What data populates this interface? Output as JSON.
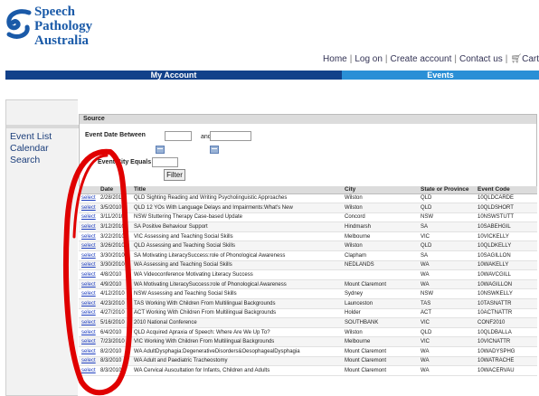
{
  "brand": {
    "line1": "Speech",
    "line2": "Pathology",
    "line3": "Australia"
  },
  "toplinks": [
    "Home",
    "Log on",
    "Create account",
    "Contact us",
    "Cart"
  ],
  "nav": {
    "account": "My Account",
    "events": "Events"
  },
  "sidebar": {
    "items": [
      "Event List",
      "Calendar",
      "Search"
    ]
  },
  "filter": {
    "section_label": "Source",
    "date_between_label": "Event Date Between",
    "and_label": "and",
    "city_label": "Event City Equals",
    "filter_button": "Filter",
    "date_from": "",
    "date_to": "",
    "city": ""
  },
  "table": {
    "headers": [
      "",
      "Date",
      "Title",
      "City",
      "State or Province",
      "Event Code"
    ],
    "select_label": "select",
    "rows": [
      [
        "2/28/2010",
        "QLD Sighting Reading and Writing Psycholinguistic Approaches",
        "Wilston",
        "QLD",
        "10QLDCARDE"
      ],
      [
        "3/5/2010",
        "QLD 12 YOs With Language Delays and Impairments:What's New",
        "Wilston",
        "QLD",
        "10QLDSHORT"
      ],
      [
        "3/11/2010",
        "NSW Stuttering Therapy Case-based Update",
        "Concord",
        "NSW",
        "10NSWSTUTT"
      ],
      [
        "3/12/2010",
        "SA Positive Behaviour Support",
        "Hindmarsh",
        "SA",
        "10SABEHGIL"
      ],
      [
        "3/22/2010",
        "VIC Assessing and Teaching Social Skills",
        "Melbourne",
        "VIC",
        "10VICKELLY"
      ],
      [
        "3/26/2010",
        "QLD Assessing and Teaching Social Skills",
        "Wilston",
        "QLD",
        "10QLDKELLY"
      ],
      [
        "3/30/2010",
        "SA Motivating LiteracySuccess:role of Phonological Awareness",
        "Clapham",
        "SA",
        "10SAGILLON"
      ],
      [
        "3/30/2010",
        "WA Assessing and Teaching Social Skills",
        "NEDLANDS",
        "WA",
        "10WAKELLY"
      ],
      [
        "4/8/2010",
        "WA Videoconference Motivating Literacy Success",
        "",
        "WA",
        "10WAVCGILL"
      ],
      [
        "4/9/2010",
        "WA Motivating LiteracySuccess:role of Phonological Awareness",
        "Mount Claremont",
        "WA",
        "10WAGILLON"
      ],
      [
        "4/12/2010",
        "NSW Assessing and Teaching Social Skills",
        "Sydney",
        "NSW",
        "10NSWKELLY"
      ],
      [
        "4/23/2010",
        "TAS Working With Children From Multilingual Backgrounds",
        "Launceston",
        "TAS",
        "10TASNATTR"
      ],
      [
        "4/27/2010",
        "ACT Working With Children From Multilingual Backgrounds",
        "Holder",
        "ACT",
        "10ACTNATTR"
      ],
      [
        "5/16/2010",
        "2010 National Conference",
        "SOUTHBANK",
        "VIC",
        "CONF2010"
      ],
      [
        "6/4/2010",
        "QLD Acquired Apraxia of Speech: Where Are We Up To?",
        "Wilston",
        "QLD",
        "10QLDBALLA"
      ],
      [
        "7/23/2010",
        "VIC Working With Children From Multilingual Backgrounds",
        "Melbourne",
        "VIC",
        "10VICNATTR"
      ],
      [
        "8/2/2010",
        "WA AdultDysphagia:DegenerativeDisorders&OesophagealDysphagia",
        "Mount Claremont",
        "WA",
        "10WADYSPHG"
      ],
      [
        "8/3/2010",
        "WA Adult and Paediatric Tracheostomy",
        "Mount Claremont",
        "WA",
        "10WATRACHE"
      ],
      [
        "8/3/2010",
        "WA Cervical Auscultation for Infants, Children and Adults",
        "Mount Claremont",
        "WA",
        "10WACERVAU"
      ]
    ]
  },
  "colors": {
    "nav_dark": "#12418a",
    "nav_light": "#2a8fd6",
    "annotation": "#e00000",
    "logo": "#1a5aa8"
  },
  "icons": [
    "logo-swoosh-icon",
    "calendar-icon",
    "cart-icon"
  ]
}
